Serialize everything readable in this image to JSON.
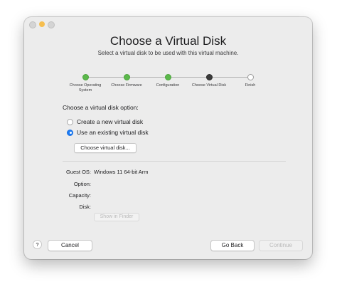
{
  "window": {
    "title": "Choose a Virtual Disk",
    "subtitle": "Select a virtual disk to be used with this virtual machine."
  },
  "steps": [
    {
      "label": "Choose Operating System",
      "state": "done"
    },
    {
      "label": "Choose Firmware",
      "state": "done"
    },
    {
      "label": "Configuration",
      "state": "done"
    },
    {
      "label": "Choose Virtual Disk",
      "state": "current"
    },
    {
      "label": "Finish",
      "state": "todo"
    }
  ],
  "disk_option": {
    "label": "Choose a virtual disk option:",
    "options": [
      {
        "label": "Create a new virtual disk",
        "selected": false
      },
      {
        "label": "Use an existing virtual disk",
        "selected": true
      }
    ],
    "choose_button": "Choose virtual disk..."
  },
  "info": {
    "guest_os_label": "Guest OS:",
    "guest_os_value": "Windows 11 64-bit Arm",
    "option_label": "Option:",
    "capacity_label": "Capacity:",
    "disk_label": "Disk:",
    "show_in_finder": "Show in Finder"
  },
  "footer": {
    "help": "?",
    "cancel": "Cancel",
    "go_back": "Go Back",
    "continue": "Continue"
  }
}
